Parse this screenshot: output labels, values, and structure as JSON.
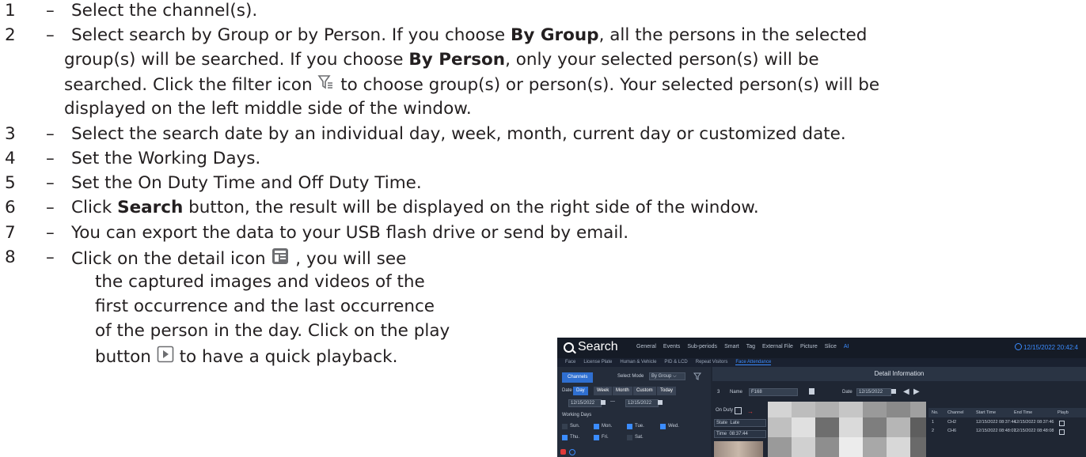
{
  "steps": [
    {
      "num": "1",
      "lines": [
        "Select the channel(s)."
      ]
    },
    {
      "num": "2",
      "lines": [
        [
          "Select search by Group or by Person. If you choose ",
          {
            "b": "By Group"
          },
          ", all the persons in the selected"
        ],
        [
          "group(s) will be searched. If you choose ",
          {
            "b": "By Person"
          },
          ", only your selected person(s) will be"
        ],
        [
          "searched. Click the filter icon ",
          {
            "icon": "filter"
          },
          " to choose group(s) or person(s). Your selected person(s) will be"
        ],
        [
          "displayed on the left middle side of the window."
        ]
      ]
    },
    {
      "num": "3",
      "lines": [
        "Select the search date by an individual day, week, month, current day or customized date."
      ]
    },
    {
      "num": "4",
      "lines": [
        "Set the Working Days."
      ]
    },
    {
      "num": "5",
      "lines": [
        "Set the On Duty Time and Off Duty Time."
      ]
    },
    {
      "num": "6",
      "lines": [
        [
          "Click ",
          {
            "b": "Search"
          },
          " button, the result will be displayed on the right side of the window."
        ]
      ]
    },
    {
      "num": "7",
      "lines": [
        "You can export the data to your USB flash drive or send by email."
      ]
    },
    {
      "num": "8",
      "lines": [
        [
          "Click on the detail icon ",
          {
            "icon": "detail"
          },
          " , you will see"
        ],
        [
          "the captured images and videos of the"
        ],
        [
          "first occurrence and the last occurrence"
        ],
        [
          "of the person in the day. Click on the play"
        ],
        [
          "button ",
          {
            "icon": "play"
          },
          " to have a quick playback."
        ]
      ]
    }
  ],
  "dash": "–",
  "screenshot": {
    "title": "Search",
    "clock": "12/15/2022 20:42:4",
    "tabs": [
      "General",
      "Events",
      "Sub-periods",
      "Smart",
      "Tag",
      "External File",
      "Picture",
      "Slice",
      "AI"
    ],
    "active_tab": "AI",
    "subtabs": [
      "Face",
      "License Plate",
      "Human & Vehicle",
      "PID & LCD",
      "Repeat Visitors",
      "Face Attendance"
    ],
    "active_subtab": "Face Attendance",
    "channels_btn": "Channels",
    "select_mode_label": "Select Mode",
    "select_mode_value": "By Group",
    "date_label": "Date",
    "date_buttons": [
      "Day",
      "Week",
      "Month",
      "Custom",
      "Today"
    ],
    "date_from": "12/15/2022",
    "date_sep": "—",
    "date_to": "12/15/2022",
    "working_days_label": "Working Days",
    "days": [
      {
        "label": "Sun.",
        "checked": false
      },
      {
        "label": "Mon.",
        "checked": true
      },
      {
        "label": "Tue.",
        "checked": true
      },
      {
        "label": "Wed.",
        "checked": true
      },
      {
        "label": "Thu.",
        "checked": true
      },
      {
        "label": "Fri.",
        "checked": true
      },
      {
        "label": "Sat.",
        "checked": false
      }
    ],
    "detail_title": "Detail Information",
    "row_no": "3",
    "name_label": "Name",
    "name_value": "F168",
    "date2_label": "Date",
    "date2_value": "12/15/2022",
    "onduty_label": "On Duty",
    "state_label": "State",
    "state_value": "Late",
    "time_label": "Time",
    "time_value": "08:37:44",
    "table_headers": [
      "No.",
      "Channel",
      "Start Time",
      "End Time",
      "Playb"
    ],
    "table_rows": [
      [
        "1",
        "CH2",
        "12/15/2022 08:37:44",
        "12/15/2022 08:37:46"
      ],
      [
        "2",
        "CH6",
        "12/15/2022 08:48:07",
        "12/15/2022 08:48:08"
      ]
    ]
  }
}
